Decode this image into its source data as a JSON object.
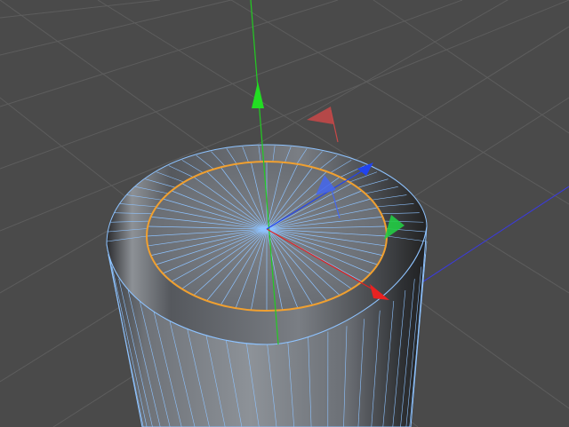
{
  "colors": {
    "background": "#4a4a4a",
    "grid": "#5d5d5d",
    "wire": "#8ec3ff",
    "selection": "#f0a030",
    "axis_x": "#e22222",
    "axis_y": "#22cc22",
    "axis_z": "#2244ee",
    "horizon_z": "#3a3ae0"
  },
  "viewport": {
    "object": "cylinder",
    "selected_edge_loop": "top-cap-outline",
    "gizmo": [
      "x-axis",
      "y-axis",
      "z-axis",
      "rotate-handles"
    ]
  },
  "icons": [
    "move-y-arrow-icon",
    "move-x-arrow-icon",
    "move-z-arrow-icon",
    "rotate-handle-icon"
  ]
}
